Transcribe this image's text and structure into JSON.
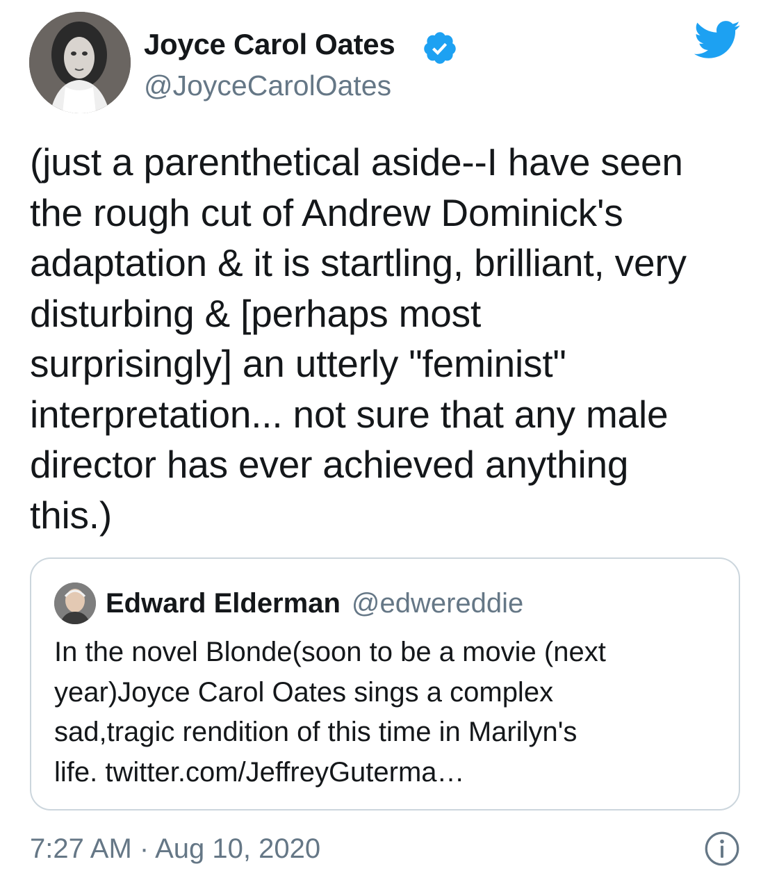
{
  "author": {
    "name": "Joyce Carol Oates",
    "handle": "@JoyceCarolOates",
    "avatar_icon": "author-avatar-photo",
    "verified_icon": "verified-badge-icon"
  },
  "brand": {
    "icon": "twitter-bird-icon",
    "color": "#1da1f2"
  },
  "tweet": {
    "text": "(just a parenthetical aside--I have seen\nthe rough cut of Andrew Dominick's\nadaptation & it is startling, brilliant, very\ndisturbing & [perhaps most\nsurprisingly] an utterly \"feminist\"\ninterpretation... not sure that any male\ndirector has ever achieved anything\nthis.)"
  },
  "quoted_tweet": {
    "name": "Edward Elderman",
    "handle": "@edwereddie",
    "text": "In the novel Blonde(soon to be a movie (next\nyear)Joyce Carol Oates sings a complex\nsad,tragic rendition of this time in Marilyn's\nlife. twitter.com/JeffreyGuterma…"
  },
  "footer": {
    "timestamp": "7:27 AM · Aug 10, 2020",
    "info_icon": "info-icon"
  },
  "colors": {
    "text_primary": "#14171a",
    "text_secondary": "#657786",
    "border": "#ccd6dd",
    "accent": "#1da1f2"
  }
}
